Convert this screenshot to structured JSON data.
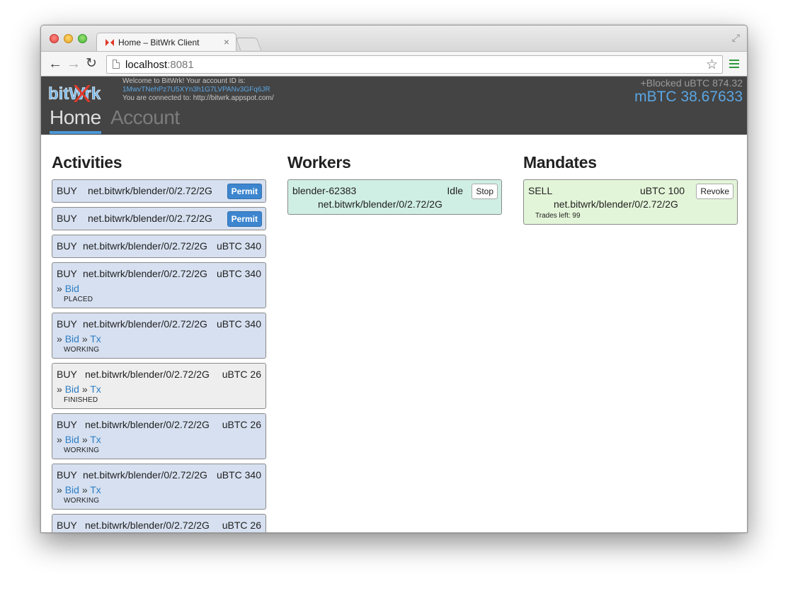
{
  "browser": {
    "tab_title": "Home – BitWrk Client",
    "url_host": "localhost",
    "url_port": ":8081"
  },
  "header": {
    "logo_text": "bitWrk",
    "welcome_line": "Welcome to BitWrk! Your account ID is:",
    "account_id": "1MwvTNehPz7U5XYn3h1G7LVPANv3GFq6JR",
    "connected_line": "You are connected to: http://bitwrk.appspot.com/",
    "blocked": "+Blocked uBTC 874.32",
    "balance": "mBTC 38.67633",
    "nav_home": "Home",
    "nav_account": "Account"
  },
  "activities": {
    "title": "Activities",
    "items": [
      {
        "type": "BUY",
        "article": "net.bitwrk/blender/0/2.72/2G",
        "button": "Permit"
      },
      {
        "type": "BUY",
        "article": "net.bitwrk/blender/0/2.72/2G",
        "button": "Permit"
      },
      {
        "type": "BUY",
        "article": "net.bitwrk/blender/0/2.72/2G",
        "amount": "uBTC 340"
      },
      {
        "type": "BUY",
        "article": "net.bitwrk/blender/0/2.72/2G",
        "amount": "uBTC 340",
        "sep1": "»",
        "bid": "Bid",
        "status": "PLACED"
      },
      {
        "type": "BUY",
        "article": "net.bitwrk/blender/0/2.72/2G",
        "amount": "uBTC 340",
        "sep1": "»",
        "bid": "Bid",
        "sep2": "»",
        "tx": "Tx",
        "status": "WORKING"
      },
      {
        "type": "BUY",
        "article": "net.bitwrk/blender/0/2.72/2G",
        "amount": "uBTC 26",
        "sep1": "»",
        "bid": "Bid",
        "sep2": "»",
        "tx": "Tx",
        "status": "FINISHED"
      },
      {
        "type": "BUY",
        "article": "net.bitwrk/blender/0/2.72/2G",
        "amount": "uBTC 26",
        "sep1": "»",
        "bid": "Bid",
        "sep2": "»",
        "tx": "Tx",
        "status": "WORKING"
      },
      {
        "type": "BUY",
        "article": "net.bitwrk/blender/0/2.72/2G",
        "amount": "uBTC 340",
        "sep1": "»",
        "bid": "Bid",
        "sep2": "»",
        "tx": "Tx",
        "status": "WORKING"
      },
      {
        "type": "BUY",
        "article": "net.bitwrk/blender/0/2.72/2G",
        "amount": "uBTC 26"
      }
    ]
  },
  "workers": {
    "title": "Workers",
    "items": [
      {
        "name": "blender-62383",
        "state": "Idle",
        "button": "Stop",
        "article": "net.bitwrk/blender/0/2.72/2G"
      }
    ]
  },
  "mandates": {
    "title": "Mandates",
    "items": [
      {
        "type": "SELL",
        "amount": "uBTC 100",
        "button": "Revoke",
        "article": "net.bitwrk/blender/0/2.72/2G",
        "trades": "Trades left: 99"
      }
    ]
  },
  "colors": {
    "header_bg": "#444444",
    "accent_blue": "#5aa6e4",
    "activity_card": "#d6e0f0",
    "worker_card": "#cfeee4",
    "mandate_card": "#e3f5d8",
    "finished_card": "#eeeeee"
  }
}
